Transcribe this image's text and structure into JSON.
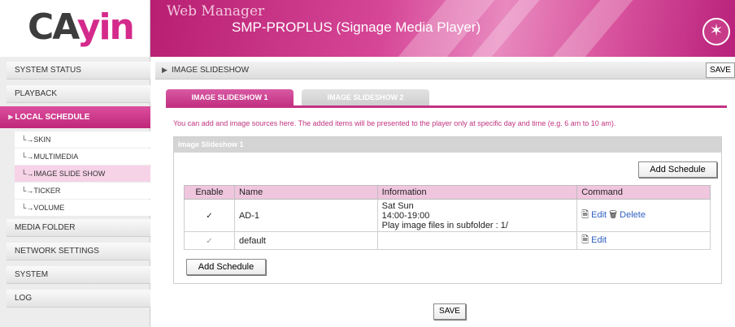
{
  "header": {
    "logo_ca": "CA",
    "logo_yin": "yin",
    "app_title": "Web Manager",
    "device_title": "SMP-PROPLUS (Signage Media Player)",
    "wand_icon": "magic-wand-icon"
  },
  "sidebar": {
    "system_status": "SYSTEM STATUS",
    "playback": "PLAYBACK",
    "local_schedule": "LOCAL SCHEDULE",
    "sub_items": [
      "└→SKIN",
      "└→MULTIMEDIA",
      "└→IMAGE SLIDE SHOW",
      "└→TICKER",
      "└→VOLUME"
    ],
    "media_folder": "MEDIA FOLDER",
    "network_settings": "NETWORK SETTINGS",
    "system": "SYSTEM",
    "log": "LOG"
  },
  "main": {
    "page_title": "IMAGE SLIDESHOW",
    "save_top": "SAVE",
    "tabs": [
      "IMAGE SLIDESHOW 1",
      "IMAGE SLIDESHOW 2"
    ],
    "notice": "You can add and image sources here. The added items will be presented to the player only at specific day and time (e.g. 6 am to 10 am).",
    "panel_title": "Image Slideshow 1",
    "add_schedule": "Add Schedule",
    "table": {
      "headers": [
        "Enable",
        "Name",
        "Information",
        "Command"
      ],
      "rows": [
        {
          "enabled": true,
          "name": "AD-1",
          "info": [
            "Sat Sun",
            "14:00-19:00",
            "Play image files in subfolder : 1/"
          ],
          "edit": "Edit",
          "delete": "Delete"
        },
        {
          "enabled": true,
          "name": "default",
          "info": [],
          "edit": "Edit"
        }
      ]
    },
    "save_bottom": "SAVE"
  }
}
